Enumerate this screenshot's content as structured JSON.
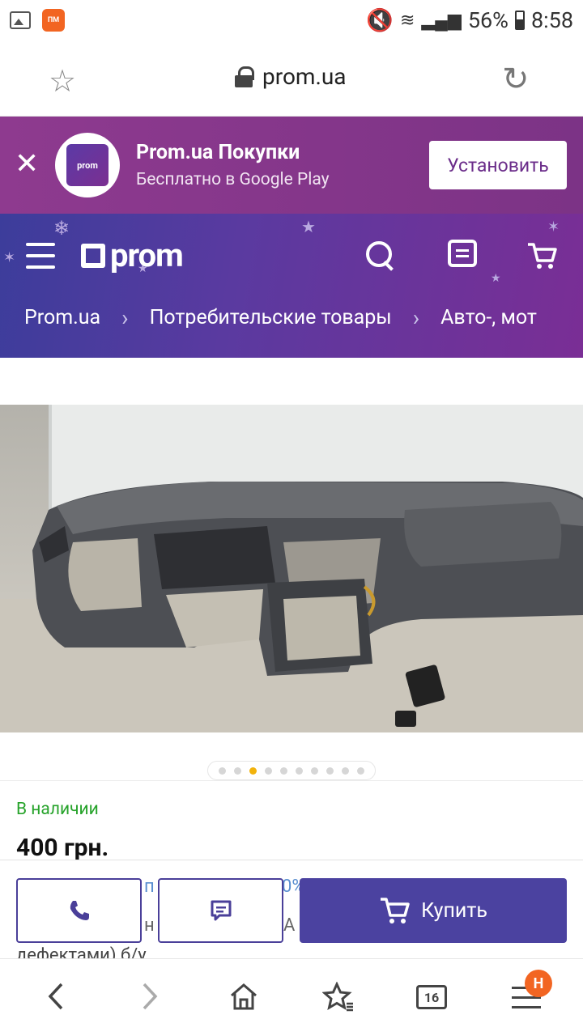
{
  "status_bar": {
    "battery": "56%",
    "time": "8:58",
    "app_icon_text": "ПМ"
  },
  "url_bar": {
    "domain": "prom.ua"
  },
  "app_banner": {
    "logo_text": "prom",
    "title": "Prom.ua Покупки",
    "subtitle": "Бесплатно в Google Play",
    "install_label": "Установить"
  },
  "header": {
    "brand": "prom",
    "breadcrumbs": [
      "Prom.ua",
      "Потребительские товары",
      "Авто-, мот"
    ]
  },
  "gallery": {
    "dot_count": 10,
    "active_index": 2
  },
  "product": {
    "availability": "В наличии",
    "price": "400 грн.",
    "peek_line1": "п",
    "peek_line1_right": "0%",
    "peek_line2": "н",
    "peek_line2_right": "А",
    "description_peek": "дефектами) б/у"
  },
  "actions": {
    "buy_label": "Купить"
  },
  "bottom_nav": {
    "tabs_count": "16",
    "badge": "Н"
  },
  "colors": {
    "banner": "#8e3a8f",
    "header": "#5a3aa0",
    "primary": "#4b42a0",
    "in_stock": "#27a32b",
    "accent": "#f2b30c",
    "badge": "#f26522"
  }
}
